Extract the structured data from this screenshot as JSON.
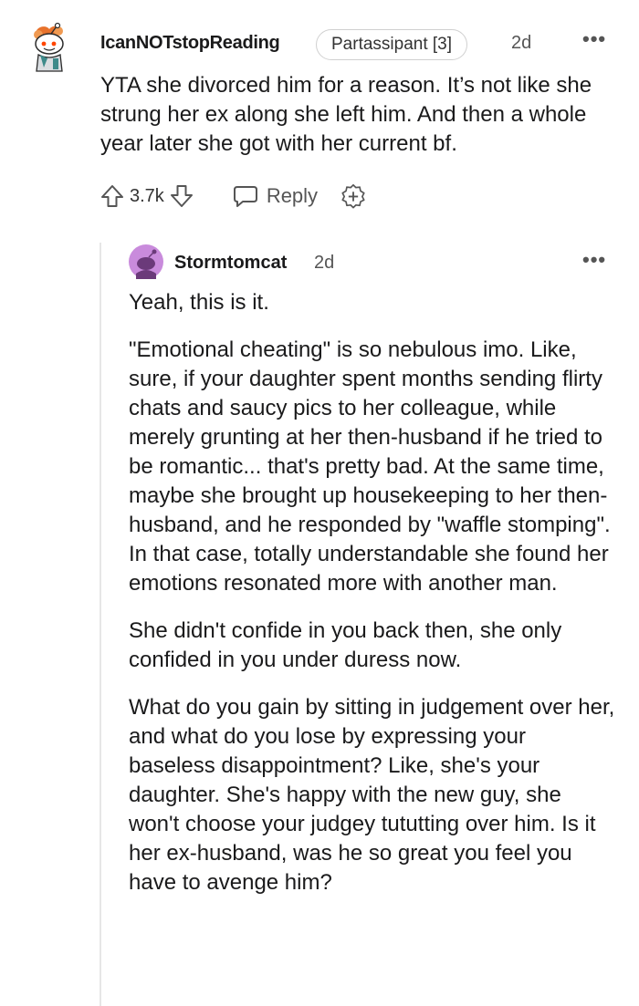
{
  "comment": {
    "author": "IcanNOTstopReading",
    "flair": "Partassipant [3]",
    "time": "2d",
    "more": "•••",
    "text": "YTA she divorced him for a reason. It’s not like she strung her ex along she left him. And then a whole year later she got with her current bf.",
    "score": "3.7k",
    "reply_label": "Reply",
    "icons": {
      "avatar": "avatar-snoo-icon",
      "upvote": "upvote-arrow-icon",
      "downvote": "downvote-arrow-icon",
      "reply": "speech-bubble-icon",
      "award": "award-plus-icon"
    }
  },
  "reply": {
    "author": "Stormtomcat",
    "time": "2d",
    "more": "•••",
    "paragraphs": [
      "Yeah, this is it.",
      "\"Emotional cheating\" is so nebulous imo. Like, sure, if your daughter spent months sending flirty chats and saucy pics to her colleague, while merely grunting at her then-husband if he tried to be romantic... that's pretty bad. At the same time, maybe she brought up housekeeping to her then-husband, and he responded by \"waffle stomping\". In that case, totally understandable she found her emotions resonated more with another man.",
      "She didn't confide in you back then, she only confided in you under duress now.",
      "What do you gain by sitting in judgement over her, and what do you lose by expressing your baseless disappointment? Like, she's your daughter. She's happy with the new guy, she won't choose your judgey tututting over him. Is it her ex-husband, was he so great you feel you have to avenge him?"
    ]
  },
  "colors": {
    "text": "#1a1a1b",
    "meta": "#555555",
    "thread_line": "#e6e6e6",
    "avatar_purple": "#c98bdc"
  }
}
